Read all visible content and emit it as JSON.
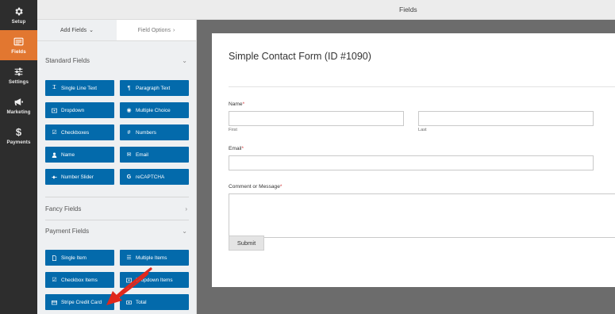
{
  "nav": {
    "items": [
      {
        "label": "Setup",
        "icon": "gear-icon",
        "active": false
      },
      {
        "label": "Fields",
        "icon": "fields-icon",
        "active": true
      },
      {
        "label": "Settings",
        "icon": "sliders-icon",
        "active": false
      },
      {
        "label": "Marketing",
        "icon": "megaphone-icon",
        "active": false
      },
      {
        "label": "Payments",
        "icon": "dollar-icon",
        "active": false
      }
    ]
  },
  "header": {
    "title": "Fields"
  },
  "panel": {
    "tabs": [
      {
        "label": "Add Fields",
        "chevron": "⌄"
      },
      {
        "label": "Field Options",
        "chevron": "›"
      }
    ],
    "sections": {
      "standard": {
        "title": "Standard Fields",
        "arrow": "⌄",
        "buttons": [
          {
            "label": "Single Line Text",
            "icon": "text-icon"
          },
          {
            "label": "Paragraph Text",
            "icon": "paragraph-icon"
          },
          {
            "label": "Dropdown",
            "icon": "dropdown-icon"
          },
          {
            "label": "Multiple Choice",
            "icon": "multiple-choice-icon"
          },
          {
            "label": "Checkboxes",
            "icon": "checkbox-icon"
          },
          {
            "label": "Numbers",
            "icon": "hash-icon"
          },
          {
            "label": "Name",
            "icon": "user-icon"
          },
          {
            "label": "Email",
            "icon": "envelope-icon"
          },
          {
            "label": "Number Slider",
            "icon": "slider-icon"
          },
          {
            "label": "reCAPTCHA",
            "icon": "google-icon"
          }
        ]
      },
      "fancy": {
        "title": "Fancy Fields",
        "arrow": "›"
      },
      "payment": {
        "title": "Payment Fields",
        "arrow": "⌄",
        "buttons": [
          {
            "label": "Single Item",
            "icon": "document-icon"
          },
          {
            "label": "Multiple Items",
            "icon": "list-icon"
          },
          {
            "label": "Checkbox Items",
            "icon": "checkbox-icon"
          },
          {
            "label": "Dropdown Items",
            "icon": "dropdown-icon"
          },
          {
            "label": "Stripe Credit Card",
            "icon": "credit-card-icon"
          },
          {
            "label": "Total",
            "icon": "money-icon"
          }
        ]
      }
    }
  },
  "form": {
    "title": "Simple Contact Form (ID #1090)",
    "fields": {
      "name": {
        "label": "Name",
        "required": "*",
        "first_sub": "First",
        "last_sub": "Last",
        "first_value": "",
        "last_value": ""
      },
      "email": {
        "label": "Email",
        "required": "*",
        "value": ""
      },
      "message": {
        "label": "Comment or Message",
        "required": "*",
        "value": ""
      }
    },
    "submit_label": "Submit"
  },
  "colors": {
    "accent_orange": "#e27730",
    "button_blue": "#036aab",
    "nav_bg": "#2d2d2d",
    "annotation_red": "#e0281d"
  }
}
